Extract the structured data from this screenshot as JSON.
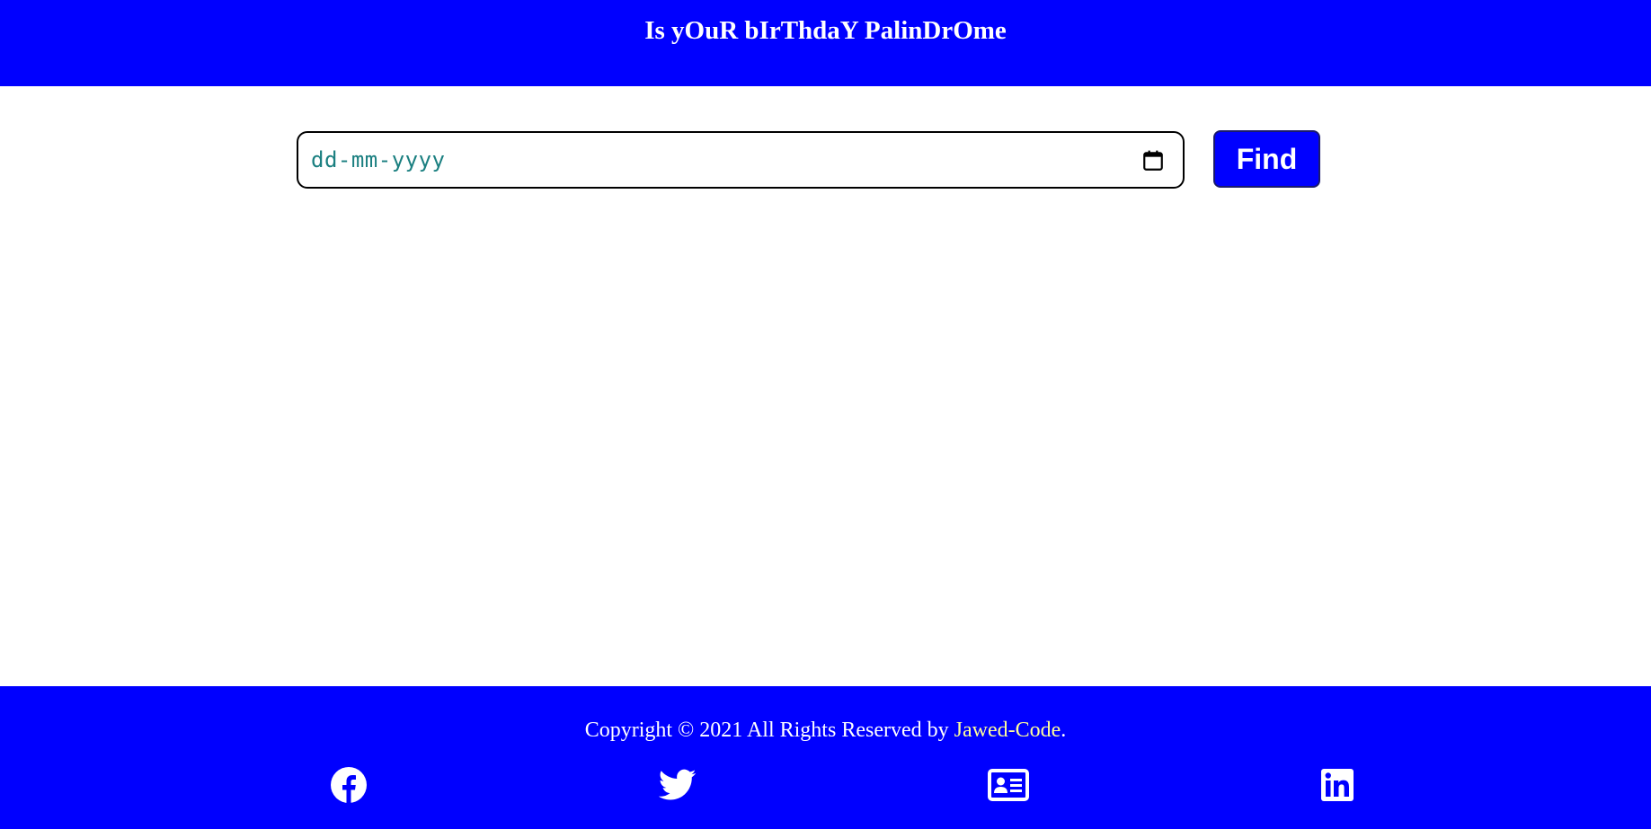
{
  "header": {
    "title": "Is yOuR bIrThdaY PalinDrOme"
  },
  "form": {
    "date_placeholder": "dd-mm-yyyy",
    "calendar_icon": "calendar-icon",
    "find_label": "Find"
  },
  "footer": {
    "copyright_prefix": "Copyright © 2021 All Rights Reserved by ",
    "author_link": "Jawed-Code",
    "copyright_suffix": ".",
    "social": [
      {
        "icon": "facebook-icon"
      },
      {
        "icon": "twitter-icon"
      },
      {
        "icon": "portfolio-card-icon"
      },
      {
        "icon": "linkedin-icon"
      }
    ]
  },
  "colors": {
    "brand": "#0000ff",
    "link": "#ffff99",
    "placeholder": "#1a7f80"
  }
}
